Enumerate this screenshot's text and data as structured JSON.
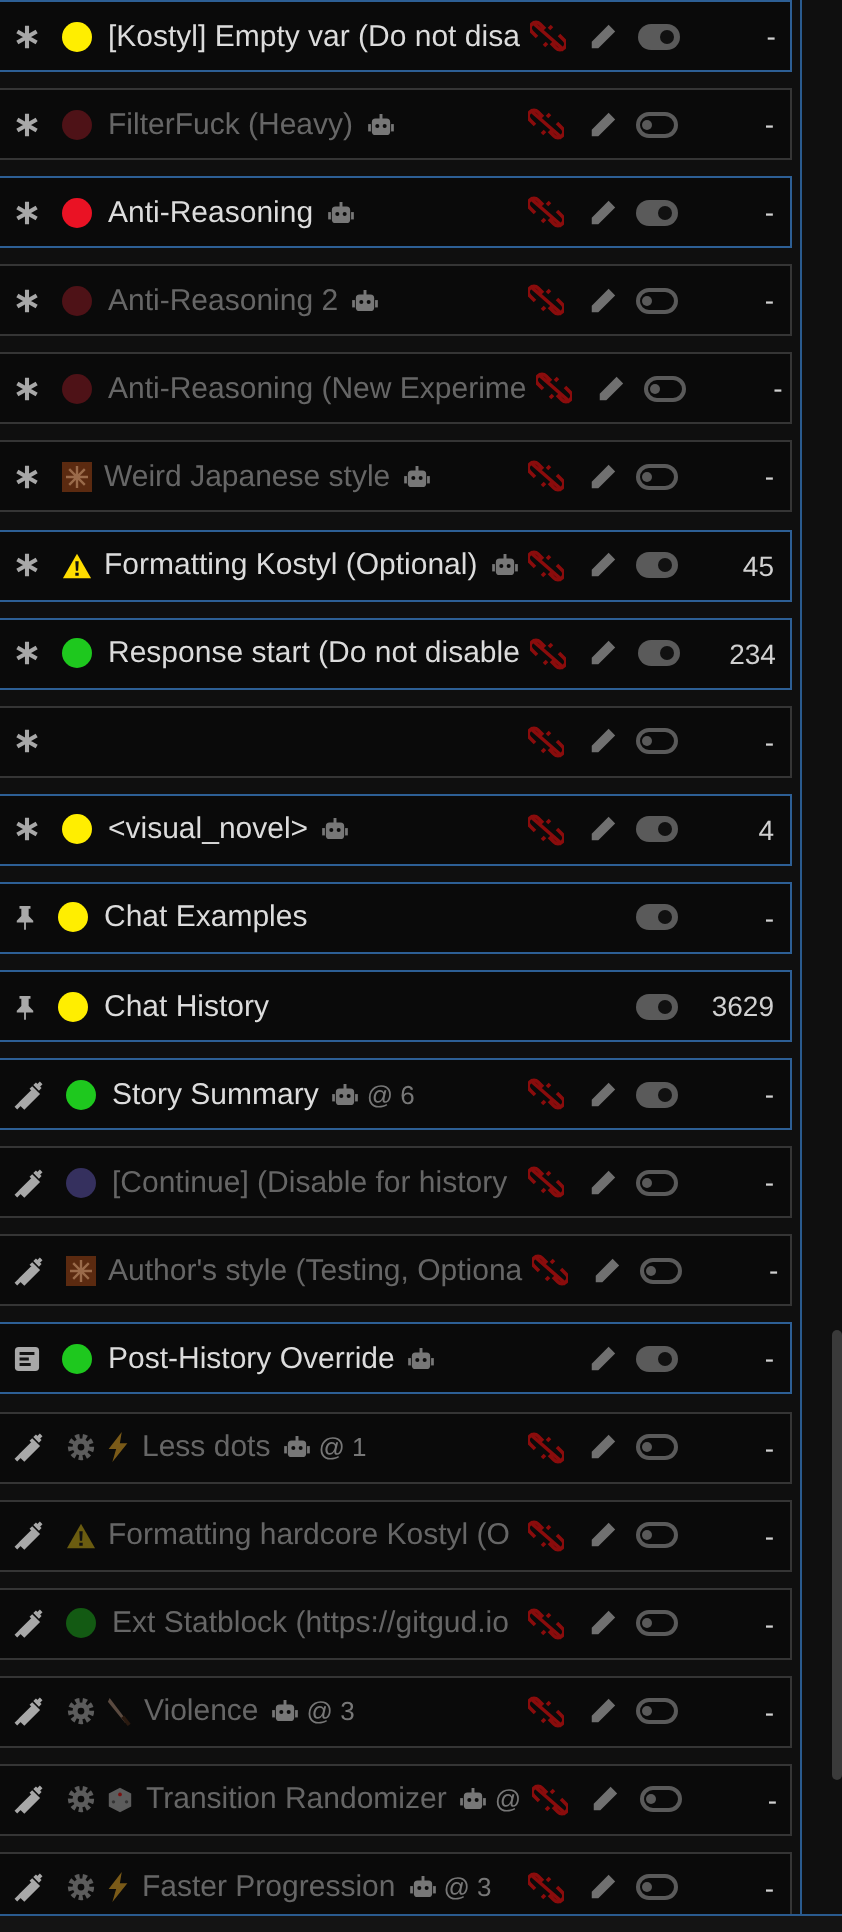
{
  "rows": [
    {
      "kind": "asterisk",
      "markers": [
        {
          "kind": "dot",
          "color": "#ffee00"
        }
      ],
      "name": "[Kostyl] Empty var (Do not disa",
      "bot": false,
      "enabled": true,
      "link_icon": true,
      "edit_icon": true,
      "tokens": "-"
    },
    {
      "kind": "asterisk",
      "markers": [
        {
          "kind": "dot",
          "color": "#4e1217"
        }
      ],
      "name": "FilterFuck (Heavy)",
      "bot": true,
      "enabled": false,
      "link_icon": true,
      "edit_icon": true,
      "tokens": "-"
    },
    {
      "kind": "asterisk",
      "markers": [
        {
          "kind": "dot",
          "color": "#ea1224"
        }
      ],
      "name": "Anti-Reasoning",
      "bot": true,
      "enabled": true,
      "link_icon": true,
      "edit_icon": true,
      "tokens": "-"
    },
    {
      "kind": "asterisk",
      "markers": [
        {
          "kind": "dot",
          "color": "#4e1217"
        }
      ],
      "name": "Anti-Reasoning 2",
      "bot": true,
      "enabled": false,
      "link_icon": true,
      "edit_icon": true,
      "tokens": "-"
    },
    {
      "kind": "asterisk",
      "markers": [
        {
          "kind": "dot",
          "color": "#4e1217"
        }
      ],
      "name": "Anti-Reasoning (New Experime",
      "bot": false,
      "enabled": false,
      "link_icon": true,
      "edit_icon": true,
      "tokens": "-"
    },
    {
      "kind": "asterisk",
      "markers": [
        {
          "kind": "sparkle"
        }
      ],
      "name": "Weird Japanese style",
      "bot": true,
      "enabled": false,
      "link_icon": true,
      "edit_icon": true,
      "tokens": "-"
    },
    {
      "kind": "asterisk",
      "markers": [
        {
          "kind": "warning"
        }
      ],
      "name": "Formatting Kostyl (Optional)",
      "bot": true,
      "enabled": true,
      "link_icon": true,
      "edit_icon": true,
      "tokens": "45"
    },
    {
      "kind": "asterisk",
      "markers": [
        {
          "kind": "dot",
          "color": "#1ec81e"
        }
      ],
      "name": "Response start (Do not disable",
      "bot": false,
      "enabled": true,
      "link_icon": true,
      "edit_icon": true,
      "tokens": "234"
    },
    {
      "kind": "asterisk",
      "markers": [],
      "bot": false,
      "enabled": false,
      "link_icon": true,
      "edit_icon": true,
      "tokens": "-"
    },
    {
      "kind": "asterisk",
      "markers": [
        {
          "kind": "dot",
          "color": "#ffee00"
        }
      ],
      "name": "<visual_novel>",
      "bot": true,
      "enabled": true,
      "link_icon": true,
      "edit_icon": true,
      "tokens": "4"
    },
    {
      "kind": "pin",
      "markers": [
        {
          "kind": "dot",
          "color": "#ffee00"
        }
      ],
      "name": "Chat Examples",
      "bot": false,
      "enabled": true,
      "link_icon": false,
      "edit_icon": false,
      "tokens": "-"
    },
    {
      "kind": "pin",
      "markers": [
        {
          "kind": "dot",
          "color": "#ffee00"
        }
      ],
      "name": "Chat History",
      "bot": false,
      "enabled": true,
      "link_icon": false,
      "edit_icon": false,
      "tokens": "3629"
    },
    {
      "kind": "syringe",
      "markers": [
        {
          "kind": "dot",
          "color": "#1ec81e"
        }
      ],
      "name": "Story Summary",
      "bot": true,
      "depth": "@ 6",
      "enabled": true,
      "link_icon": true,
      "edit_icon": true,
      "tokens": "-"
    },
    {
      "kind": "syringe",
      "markers": [
        {
          "kind": "dot",
          "color": "#35305e"
        }
      ],
      "name": "[Continue] (Disable for history",
      "bot": false,
      "enabled": false,
      "link_icon": true,
      "edit_icon": true,
      "tokens": "-"
    },
    {
      "kind": "syringe",
      "markers": [
        {
          "kind": "sparkle"
        }
      ],
      "name": "Author's style (Testing, Optiona",
      "bot": false,
      "enabled": false,
      "link_icon": true,
      "edit_icon": true,
      "tokens": "-"
    },
    {
      "kind": "document",
      "markers": [
        {
          "kind": "dot",
          "color": "#1ec81e"
        }
      ],
      "name": "Post-History Override",
      "bot": true,
      "enabled": true,
      "link_icon": false,
      "edit_icon": true,
      "tokens": "-"
    },
    {
      "kind": "syringe",
      "markers": [
        {
          "kind": "gear"
        },
        {
          "kind": "lightning"
        }
      ],
      "name": "Less dots",
      "bot": true,
      "depth": "@ 1",
      "enabled": false,
      "link_icon": true,
      "edit_icon": true,
      "tokens": "-"
    },
    {
      "kind": "syringe",
      "markers": [
        {
          "kind": "warning"
        }
      ],
      "name": "Formatting hardcore Kostyl (O",
      "bot": false,
      "enabled": false,
      "link_icon": true,
      "edit_icon": true,
      "tokens": "-"
    },
    {
      "kind": "syringe",
      "markers": [
        {
          "kind": "dot",
          "color": "#135a13"
        }
      ],
      "name": "Ext Statblock (https://gitgud.io",
      "bot": false,
      "enabled": false,
      "link_icon": true,
      "edit_icon": true,
      "tokens": "-"
    },
    {
      "kind": "syringe",
      "markers": [
        {
          "kind": "gear"
        },
        {
          "kind": "knife"
        }
      ],
      "name": "Violence",
      "bot": true,
      "depth": "@ 3",
      "enabled": false,
      "link_icon": true,
      "edit_icon": true,
      "tokens": "-"
    },
    {
      "kind": "syringe",
      "markers": [
        {
          "kind": "gear"
        },
        {
          "kind": "dice"
        }
      ],
      "name": "Transition Randomizer",
      "bot": true,
      "depth": "@",
      "enabled": false,
      "link_icon": true,
      "edit_icon": true,
      "tokens": "-"
    },
    {
      "kind": "syringe",
      "markers": [
        {
          "kind": "gear"
        },
        {
          "kind": "lightning"
        }
      ],
      "name": "Faster Progression",
      "bot": true,
      "depth": "@ 3",
      "enabled": false,
      "link_icon": true,
      "edit_icon": true,
      "tokens": "-"
    }
  ]
}
